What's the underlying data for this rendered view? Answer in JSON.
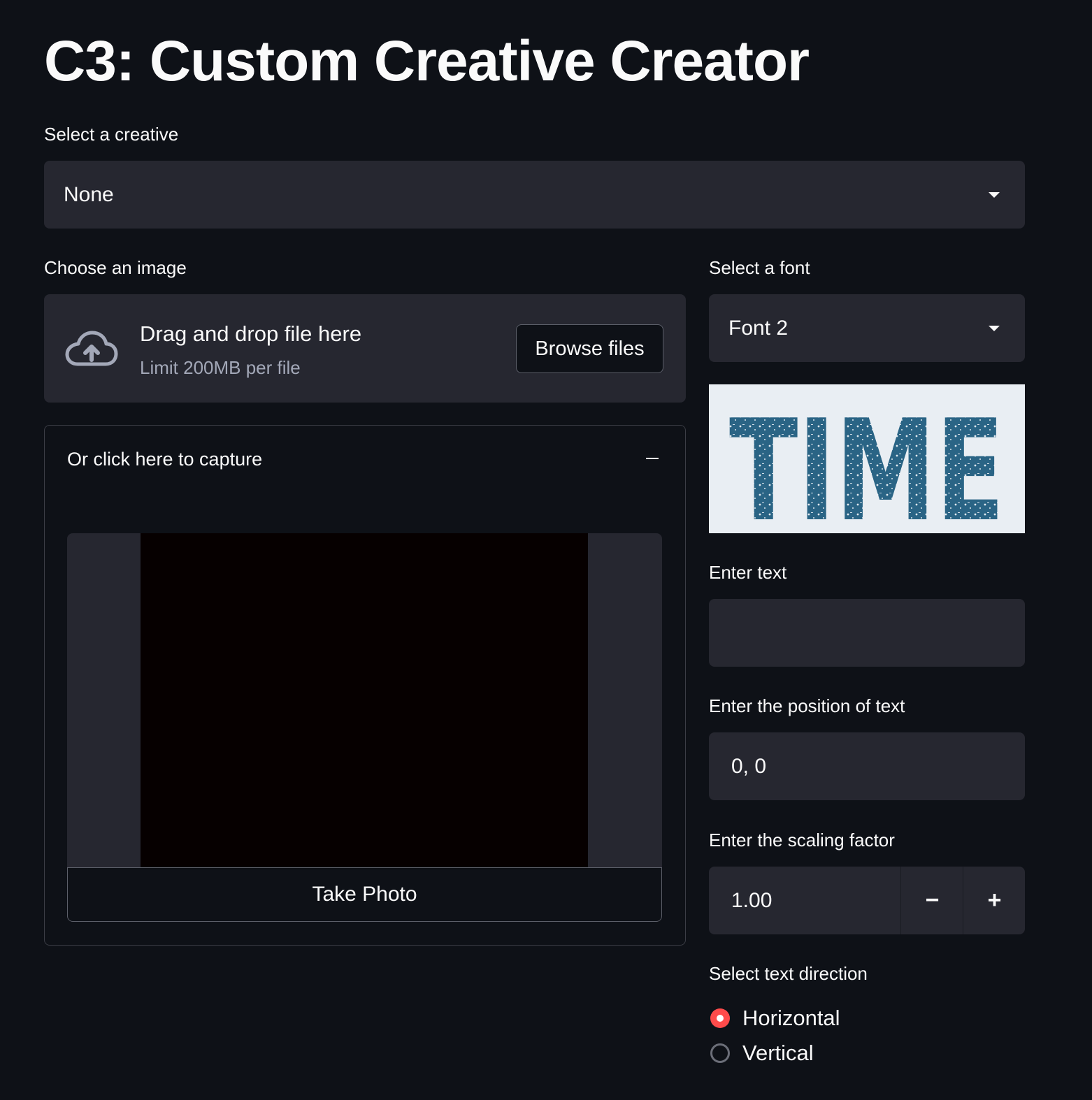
{
  "title": "C3: Custom Creative Creator",
  "creative": {
    "label": "Select a creative",
    "value": "None"
  },
  "image": {
    "label": "Choose an image",
    "drop_text": "Drag and drop file here",
    "limit_text": "Limit 200MB per file",
    "browse_label": "Browse files"
  },
  "capture": {
    "header": "Or click here to capture",
    "take_photo_label": "Take Photo"
  },
  "font": {
    "label": "Select a font",
    "value": "Font 2",
    "preview_text": "TIME"
  },
  "text_input": {
    "label": "Enter text",
    "value": ""
  },
  "position": {
    "label": "Enter the position of text",
    "value": "0, 0"
  },
  "scaling": {
    "label": "Enter the scaling factor",
    "value": "1.00",
    "decrement": "−",
    "increment": "+"
  },
  "direction": {
    "label": "Select text direction",
    "options": [
      "Horizontal",
      "Vertical"
    ],
    "selected": "Horizontal"
  },
  "colors": {
    "background": "#0e1117",
    "widget": "#262730",
    "accent": "#ff4b4b",
    "font_preview_ink": "#2a6485"
  }
}
